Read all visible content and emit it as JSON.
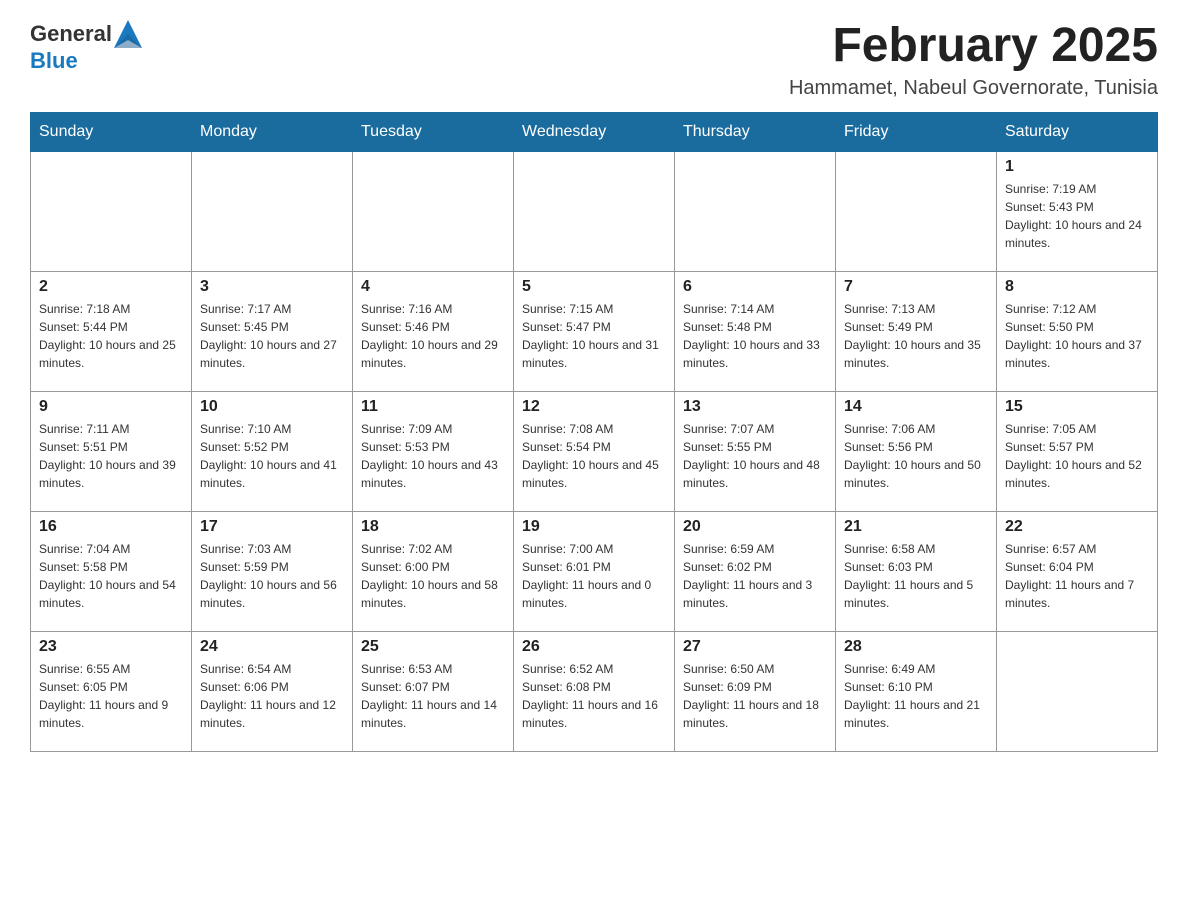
{
  "header": {
    "logo_general": "General",
    "logo_blue": "Blue",
    "month_title": "February 2025",
    "location": "Hammamet, Nabeul Governorate, Tunisia"
  },
  "days_of_week": [
    "Sunday",
    "Monday",
    "Tuesday",
    "Wednesday",
    "Thursday",
    "Friday",
    "Saturday"
  ],
  "weeks": [
    [
      {
        "day": "",
        "info": ""
      },
      {
        "day": "",
        "info": ""
      },
      {
        "day": "",
        "info": ""
      },
      {
        "day": "",
        "info": ""
      },
      {
        "day": "",
        "info": ""
      },
      {
        "day": "",
        "info": ""
      },
      {
        "day": "1",
        "info": "Sunrise: 7:19 AM\nSunset: 5:43 PM\nDaylight: 10 hours and 24 minutes."
      }
    ],
    [
      {
        "day": "2",
        "info": "Sunrise: 7:18 AM\nSunset: 5:44 PM\nDaylight: 10 hours and 25 minutes."
      },
      {
        "day": "3",
        "info": "Sunrise: 7:17 AM\nSunset: 5:45 PM\nDaylight: 10 hours and 27 minutes."
      },
      {
        "day": "4",
        "info": "Sunrise: 7:16 AM\nSunset: 5:46 PM\nDaylight: 10 hours and 29 minutes."
      },
      {
        "day": "5",
        "info": "Sunrise: 7:15 AM\nSunset: 5:47 PM\nDaylight: 10 hours and 31 minutes."
      },
      {
        "day": "6",
        "info": "Sunrise: 7:14 AM\nSunset: 5:48 PM\nDaylight: 10 hours and 33 minutes."
      },
      {
        "day": "7",
        "info": "Sunrise: 7:13 AM\nSunset: 5:49 PM\nDaylight: 10 hours and 35 minutes."
      },
      {
        "day": "8",
        "info": "Sunrise: 7:12 AM\nSunset: 5:50 PM\nDaylight: 10 hours and 37 minutes."
      }
    ],
    [
      {
        "day": "9",
        "info": "Sunrise: 7:11 AM\nSunset: 5:51 PM\nDaylight: 10 hours and 39 minutes."
      },
      {
        "day": "10",
        "info": "Sunrise: 7:10 AM\nSunset: 5:52 PM\nDaylight: 10 hours and 41 minutes."
      },
      {
        "day": "11",
        "info": "Sunrise: 7:09 AM\nSunset: 5:53 PM\nDaylight: 10 hours and 43 minutes."
      },
      {
        "day": "12",
        "info": "Sunrise: 7:08 AM\nSunset: 5:54 PM\nDaylight: 10 hours and 45 minutes."
      },
      {
        "day": "13",
        "info": "Sunrise: 7:07 AM\nSunset: 5:55 PM\nDaylight: 10 hours and 48 minutes."
      },
      {
        "day": "14",
        "info": "Sunrise: 7:06 AM\nSunset: 5:56 PM\nDaylight: 10 hours and 50 minutes."
      },
      {
        "day": "15",
        "info": "Sunrise: 7:05 AM\nSunset: 5:57 PM\nDaylight: 10 hours and 52 minutes."
      }
    ],
    [
      {
        "day": "16",
        "info": "Sunrise: 7:04 AM\nSunset: 5:58 PM\nDaylight: 10 hours and 54 minutes."
      },
      {
        "day": "17",
        "info": "Sunrise: 7:03 AM\nSunset: 5:59 PM\nDaylight: 10 hours and 56 minutes."
      },
      {
        "day": "18",
        "info": "Sunrise: 7:02 AM\nSunset: 6:00 PM\nDaylight: 10 hours and 58 minutes."
      },
      {
        "day": "19",
        "info": "Sunrise: 7:00 AM\nSunset: 6:01 PM\nDaylight: 11 hours and 0 minutes."
      },
      {
        "day": "20",
        "info": "Sunrise: 6:59 AM\nSunset: 6:02 PM\nDaylight: 11 hours and 3 minutes."
      },
      {
        "day": "21",
        "info": "Sunrise: 6:58 AM\nSunset: 6:03 PM\nDaylight: 11 hours and 5 minutes."
      },
      {
        "day": "22",
        "info": "Sunrise: 6:57 AM\nSunset: 6:04 PM\nDaylight: 11 hours and 7 minutes."
      }
    ],
    [
      {
        "day": "23",
        "info": "Sunrise: 6:55 AM\nSunset: 6:05 PM\nDaylight: 11 hours and 9 minutes."
      },
      {
        "day": "24",
        "info": "Sunrise: 6:54 AM\nSunset: 6:06 PM\nDaylight: 11 hours and 12 minutes."
      },
      {
        "day": "25",
        "info": "Sunrise: 6:53 AM\nSunset: 6:07 PM\nDaylight: 11 hours and 14 minutes."
      },
      {
        "day": "26",
        "info": "Sunrise: 6:52 AM\nSunset: 6:08 PM\nDaylight: 11 hours and 16 minutes."
      },
      {
        "day": "27",
        "info": "Sunrise: 6:50 AM\nSunset: 6:09 PM\nDaylight: 11 hours and 18 minutes."
      },
      {
        "day": "28",
        "info": "Sunrise: 6:49 AM\nSunset: 6:10 PM\nDaylight: 11 hours and 21 minutes."
      },
      {
        "day": "",
        "info": ""
      }
    ]
  ]
}
